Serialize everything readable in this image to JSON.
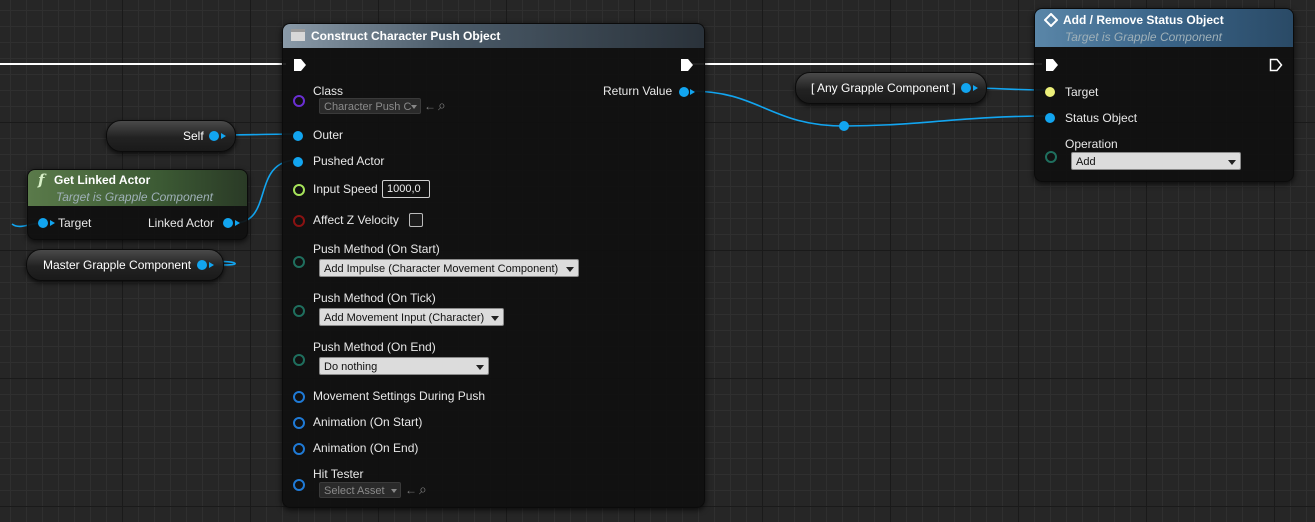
{
  "construct": {
    "title": "Construct Character Push Object",
    "pins": {
      "class": "Class",
      "outer": "Outer",
      "pushed_actor": "Pushed Actor",
      "input_speed": "Input Speed",
      "affect_z": "Affect Z Velocity",
      "push_start": "Push Method (On Start)",
      "push_tick": "Push Method (On Tick)",
      "push_end": "Push Method (On End)",
      "movement_settings": "Movement Settings During Push",
      "anim_start": "Animation (On Start)",
      "anim_end": "Animation (On End)",
      "hit_tester": "Hit Tester",
      "return_value": "Return Value"
    },
    "class_value": "Character Push C",
    "input_speed_value": "1000,0",
    "push_start_value": "Add Impulse (Character Movement Component)",
    "push_tick_value": "Add Movement Input (Character)",
    "push_end_value": "Do nothing",
    "hit_tester_value": "Select Asset"
  },
  "add_remove": {
    "title": "Add / Remove Status Object",
    "subtitle": "Target is Grapple Component",
    "pins": {
      "target": "Target",
      "status_object": "Status Object",
      "operation": "Operation"
    },
    "operation_value": "Add"
  },
  "get_linked_actor": {
    "title": "Get Linked Actor",
    "subtitle": "Target is Grapple Component",
    "target": "Target",
    "linked_actor": "Linked Actor"
  },
  "self_node": {
    "label": "Self"
  },
  "master_grapple": {
    "label": "Master Grapple Component"
  },
  "any_grapple": {
    "label": "[ Any Grapple Component ]"
  },
  "icons": {
    "function": "f",
    "browse": "←",
    "search": "⌕"
  },
  "colors": {
    "object_pin": "#12a5f0",
    "class_pin": "#6a2fd2",
    "float_pin": "#a6e35a",
    "bool_pin": "#8a1212",
    "enum_pin": "#1f6f5e",
    "struct_pin": "#1f7ad6",
    "target_pin": "#ecf07a"
  }
}
